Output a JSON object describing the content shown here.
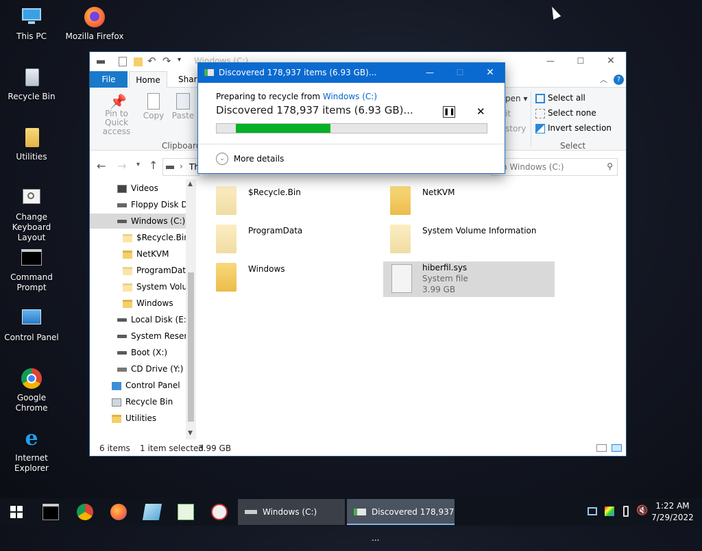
{
  "desktop": {
    "icons": [
      {
        "label": "This PC"
      },
      {
        "label": "Mozilla Firefox"
      },
      {
        "label": "Recycle Bin"
      },
      {
        "label": "Utilities"
      },
      {
        "label": "Change Keyboard Layout"
      },
      {
        "label": "Command Prompt"
      },
      {
        "label": "Control Panel"
      },
      {
        "label": "Google Chrome"
      },
      {
        "label": "Internet Explorer"
      }
    ]
  },
  "explorer": {
    "title": "Windows (C:)",
    "tabs": [
      "File",
      "Home",
      "Share"
    ],
    "ribbon": {
      "pin_label": "Pin to Quick access",
      "copy_label": "Copy",
      "paste_label": "Paste",
      "clipboard_group": "Clipboard",
      "open_partial": "pen",
      "edit_partial": "it",
      "history_partial": "story",
      "select_all": "Select all",
      "select_none": "Select none",
      "invert_selection": "Invert selection",
      "select_group": "Select"
    },
    "address_partial": "Th",
    "search_placeholder": "h Windows (C:)",
    "nav": [
      {
        "label": "Videos"
      },
      {
        "label": "Floppy Disk Dri"
      },
      {
        "label": "Windows (C:)"
      },
      {
        "label": "$Recycle.Bin"
      },
      {
        "label": "NetKVM"
      },
      {
        "label": "ProgramData"
      },
      {
        "label": "System Volun"
      },
      {
        "label": "Windows"
      },
      {
        "label": "Local Disk (E:)"
      },
      {
        "label": "System Reserve"
      },
      {
        "label": "Boot (X:)"
      },
      {
        "label": "CD Drive (Y:) H"
      },
      {
        "label": "Control Panel"
      },
      {
        "label": "Recycle Bin"
      },
      {
        "label": "Utilities"
      }
    ],
    "files": [
      {
        "name": "$Recycle.Bin"
      },
      {
        "name": "NetKVM"
      },
      {
        "name": "ProgramData"
      },
      {
        "name": "System Volume Information"
      },
      {
        "name": "Windows"
      },
      {
        "name": "hiberfil.sys",
        "type": "System file",
        "size": "3.99 GB"
      }
    ],
    "status": {
      "count": "6 items",
      "selected": "1 item selected",
      "size": "3.99 GB"
    }
  },
  "dialog": {
    "title": "Discovered 178,937 items (6.93 GB)...",
    "preparing_prefix": "Preparing to recycle from",
    "source_link": "Windows (C:)",
    "headline": "Discovered 178,937 items (6.93 GB)...",
    "progress": 0.35,
    "more_details": "More details"
  },
  "taskbar": {
    "explorer_btn": "Windows (C:)",
    "dialog_btn": "Discovered 178,937 ...",
    "time": "1:22 AM",
    "date": "7/29/2022"
  },
  "colors": {
    "accent": "#0b6ad0",
    "progress": "#06b025",
    "file_tab": "#1979ca"
  }
}
